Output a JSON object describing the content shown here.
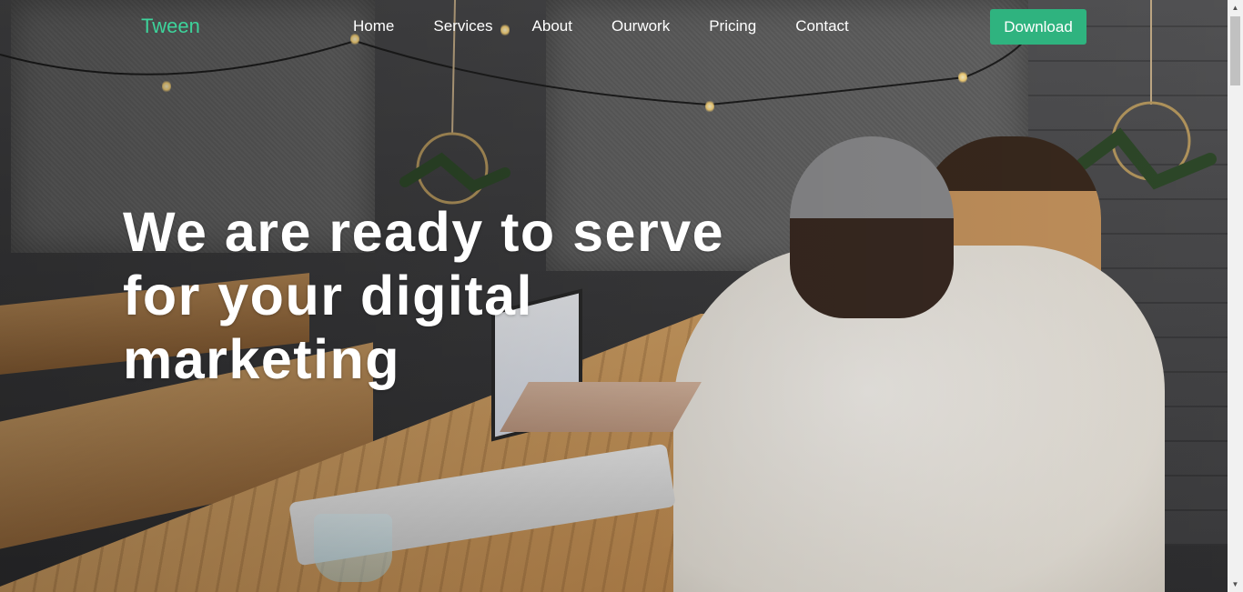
{
  "brand": {
    "logo_text": "Tween"
  },
  "nav": {
    "items": [
      {
        "label": "Home"
      },
      {
        "label": "Services"
      },
      {
        "label": "About"
      },
      {
        "label": "Ourwork"
      },
      {
        "label": "Pricing"
      },
      {
        "label": "Contact"
      }
    ],
    "download_label": "Download"
  },
  "hero": {
    "title_line_1": "We are ready to serve",
    "title_line_2": "for your digital",
    "title_line_3": "marketing",
    "background_icon": "cafe-photo"
  },
  "colors": {
    "brand_green": "#3dd39b",
    "button_green": "#2fb37f",
    "text_white": "#ffffff"
  },
  "scrollbar": {
    "up_icon": "triangle-up-icon",
    "down_icon": "triangle-down-icon"
  }
}
